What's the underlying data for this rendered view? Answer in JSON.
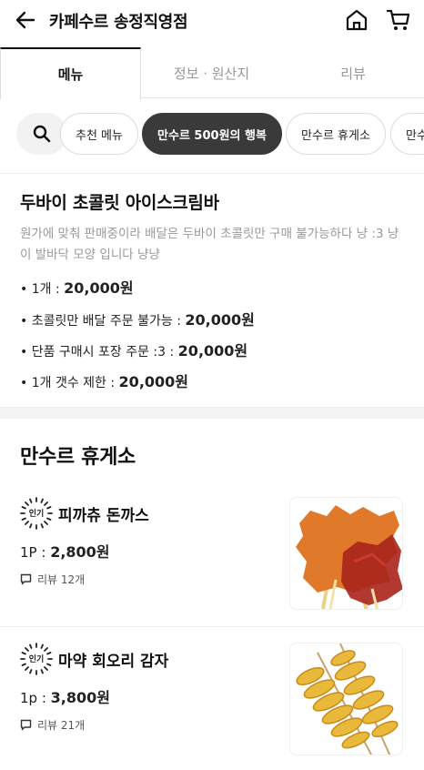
{
  "header": {
    "store_name": "카페수르 송정직영점",
    "icons": [
      "back-arrow-icon",
      "home-icon",
      "cart-icon"
    ]
  },
  "tabs": [
    {
      "label": "메뉴",
      "active": true
    },
    {
      "label": "정보 · 원산지",
      "active": false
    },
    {
      "label": "리뷰",
      "active": false
    }
  ],
  "chips": [
    {
      "label": "추천 메뉴",
      "active": false
    },
    {
      "label": "만수르 500원의 행복",
      "active": true
    },
    {
      "label": "만수르 휴게소",
      "active": false
    },
    {
      "label": "만수",
      "active": false
    }
  ],
  "notice": {
    "title": "두바이 초콜릿 아이스크림바",
    "description": "원가에 맞춰 판매중이라  배달은 두바이 초콜릿만 구매 불가능하다 냥 :3 냥이 발바닥 모양 입니다 냥냥",
    "bullets": [
      {
        "label": "• 1개 : ",
        "value": "20,000원"
      },
      {
        "label": "• 초콜릿만 배달 주문 불가능 : ",
        "value": "20,000원"
      },
      {
        "label": "• 단품 구매시 포장 주문 :3 : ",
        "value": "20,000원"
      },
      {
        "label": "• 1개 갯수 제한 : ",
        "value": "20,000원"
      }
    ]
  },
  "category": {
    "title": "만수르 휴게소",
    "items": [
      {
        "badge": "인기",
        "name": "피까츄 돈까스",
        "price_label": "1P : ",
        "price": "2,800원",
        "review": "리뷰 12개"
      },
      {
        "badge": "인기",
        "name": "마약 회오리 감자",
        "price_label": "1p : ",
        "price": "3,800원",
        "review": "리뷰 21개"
      }
    ]
  }
}
